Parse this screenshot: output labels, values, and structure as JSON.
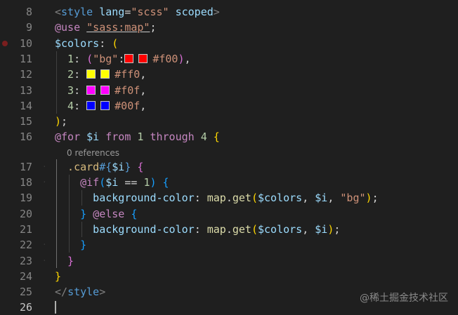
{
  "editor": {
    "lines": [
      {
        "n": "8",
        "parts": [
          {
            "t": "<",
            "c": "t-punct"
          },
          {
            "t": "style",
            "c": "t-tag"
          },
          {
            "t": " ",
            "c": "t-white"
          },
          {
            "t": "lang",
            "c": "t-attr"
          },
          {
            "t": "=",
            "c": "t-white"
          },
          {
            "t": "\"scss\"",
            "c": "t-str"
          },
          {
            "t": " ",
            "c": "t-white"
          },
          {
            "t": "scoped",
            "c": "t-attr"
          },
          {
            "t": ">",
            "c": "t-punct"
          }
        ]
      },
      {
        "n": "9",
        "parts": [
          {
            "t": "@use",
            "c": "t-at"
          },
          {
            "t": " ",
            "c": "t-white"
          },
          {
            "t": "\"sass:map\"",
            "c": "t-str sq-under"
          },
          {
            "t": ";",
            "c": "t-white"
          }
        ]
      },
      {
        "n": "10",
        "breakpoint": true,
        "parts": [
          {
            "t": "$colors",
            "c": "t-var"
          },
          {
            "t": ": ",
            "c": "t-white"
          },
          {
            "t": "(",
            "c": "t-bracket1"
          }
        ]
      },
      {
        "n": "11",
        "parts": [
          {
            "t": "  1",
            "c": "t-num"
          },
          {
            "t": ": ",
            "c": "t-white"
          },
          {
            "t": "(",
            "c": "t-bracket2"
          },
          {
            "t": "\"bg\"",
            "c": "t-str"
          },
          {
            "t": ":",
            "c": "t-white"
          },
          {
            "swatch": "#ff0000"
          },
          {
            "swatch": "#ff0000"
          },
          {
            "t": "#f00",
            "c": "t-str"
          },
          {
            "t": ")",
            "c": "t-bracket2"
          },
          {
            "t": ",",
            "c": "t-white"
          }
        ]
      },
      {
        "n": "12",
        "parts": [
          {
            "t": "  2",
            "c": "t-num"
          },
          {
            "t": ": ",
            "c": "t-white"
          },
          {
            "swatch": "#ffff00"
          },
          {
            "swatch": "#ffff00"
          },
          {
            "t": "#ff0",
            "c": "t-str"
          },
          {
            "t": ",",
            "c": "t-white"
          }
        ]
      },
      {
        "n": "13",
        "parts": [
          {
            "t": "  3",
            "c": "t-num"
          },
          {
            "t": ": ",
            "c": "t-white"
          },
          {
            "swatch": "#ff00ff"
          },
          {
            "swatch": "#ff00ff"
          },
          {
            "t": "#f0f",
            "c": "t-str"
          },
          {
            "t": ",",
            "c": "t-white"
          }
        ]
      },
      {
        "n": "14",
        "parts": [
          {
            "t": "  4",
            "c": "t-num"
          },
          {
            "t": ": ",
            "c": "t-white"
          },
          {
            "swatch": "#0000ff"
          },
          {
            "swatch": "#0000ff"
          },
          {
            "t": "#00f",
            "c": "t-str"
          },
          {
            "t": ",",
            "c": "t-white"
          }
        ]
      },
      {
        "n": "15",
        "parts": [
          {
            "t": ")",
            "c": "t-bracket1"
          },
          {
            "t": ";",
            "c": "t-white"
          }
        ]
      },
      {
        "n": "16",
        "parts": [
          {
            "t": "@for",
            "c": "t-at"
          },
          {
            "t": " ",
            "c": "t-white"
          },
          {
            "t": "$i",
            "c": "t-var"
          },
          {
            "t": " ",
            "c": "t-white"
          },
          {
            "t": "from",
            "c": "t-kw"
          },
          {
            "t": " ",
            "c": "t-white"
          },
          {
            "t": "1",
            "c": "t-num"
          },
          {
            "t": " ",
            "c": "t-white"
          },
          {
            "t": "through",
            "c": "t-kw"
          },
          {
            "t": " ",
            "c": "t-white"
          },
          {
            "t": "4",
            "c": "t-num"
          },
          {
            "t": " ",
            "c": "t-white"
          },
          {
            "t": "{",
            "c": "t-bracket1"
          }
        ],
        "codelens": "0 references"
      },
      {
        "n": "17",
        "parts": [
          {
            "t": "  .card",
            "c": "t-sel"
          },
          {
            "t": "#{",
            "c": "t-interp"
          },
          {
            "t": "$i",
            "c": "t-var"
          },
          {
            "t": "}",
            "c": "t-interp"
          },
          {
            "t": " ",
            "c": "t-white"
          },
          {
            "t": "{",
            "c": "t-bracket2"
          }
        ]
      },
      {
        "n": "18",
        "parts": [
          {
            "t": "    @if",
            "c": "t-at"
          },
          {
            "t": "(",
            "c": "t-bracket3"
          },
          {
            "t": "$i",
            "c": "t-var"
          },
          {
            "t": " == ",
            "c": "t-white"
          },
          {
            "t": "1",
            "c": "t-num"
          },
          {
            "t": ")",
            "c": "t-bracket3"
          },
          {
            "t": " ",
            "c": "t-white"
          },
          {
            "t": "{",
            "c": "t-bracket3"
          }
        ]
      },
      {
        "n": "19",
        "parts": [
          {
            "t": "      background-color",
            "c": "t-prop"
          },
          {
            "t": ": ",
            "c": "t-white"
          },
          {
            "t": "map",
            "c": "t-func"
          },
          {
            "t": ".",
            "c": "t-white"
          },
          {
            "t": "get",
            "c": "t-func"
          },
          {
            "t": "(",
            "c": "t-bracket1"
          },
          {
            "t": "$colors",
            "c": "t-var"
          },
          {
            "t": ", ",
            "c": "t-white"
          },
          {
            "t": "$i",
            "c": "t-var"
          },
          {
            "t": ", ",
            "c": "t-white"
          },
          {
            "t": "\"bg\"",
            "c": "t-str"
          },
          {
            "t": ")",
            "c": "t-bracket1"
          },
          {
            "t": ";",
            "c": "t-white"
          }
        ]
      },
      {
        "n": "20",
        "parts": [
          {
            "t": "    }",
            "c": "t-bracket3"
          },
          {
            "t": " ",
            "c": "t-white"
          },
          {
            "t": "@else",
            "c": "t-at"
          },
          {
            "t": " ",
            "c": "t-white"
          },
          {
            "t": "{",
            "c": "t-bracket3"
          }
        ]
      },
      {
        "n": "21",
        "parts": [
          {
            "t": "      background-color",
            "c": "t-prop"
          },
          {
            "t": ": ",
            "c": "t-white"
          },
          {
            "t": "map",
            "c": "t-func"
          },
          {
            "t": ".",
            "c": "t-white"
          },
          {
            "t": "get",
            "c": "t-func"
          },
          {
            "t": "(",
            "c": "t-bracket1"
          },
          {
            "t": "$colors",
            "c": "t-var"
          },
          {
            "t": ", ",
            "c": "t-white"
          },
          {
            "t": "$i",
            "c": "t-var"
          },
          {
            "t": ")",
            "c": "t-bracket1"
          },
          {
            "t": ";",
            "c": "t-white"
          }
        ]
      },
      {
        "n": "22",
        "parts": [
          {
            "t": "    }",
            "c": "t-bracket3"
          }
        ]
      },
      {
        "n": "23",
        "parts": [
          {
            "t": "  }",
            "c": "t-bracket2"
          }
        ]
      },
      {
        "n": "24",
        "parts": [
          {
            "t": "}",
            "c": "t-bracket1"
          }
        ]
      },
      {
        "n": "25",
        "parts": [
          {
            "t": "</",
            "c": "t-punct"
          },
          {
            "t": "style",
            "c": "t-tag"
          },
          {
            "t": ">",
            "c": "t-punct"
          }
        ]
      },
      {
        "n": "26",
        "active": true,
        "parts": []
      }
    ]
  },
  "watermark": "@稀土掘金技术社区",
  "colors": {
    "background": "#1f1f1f",
    "line_number": "#858585",
    "breakpoint": "#7a1e1e"
  }
}
